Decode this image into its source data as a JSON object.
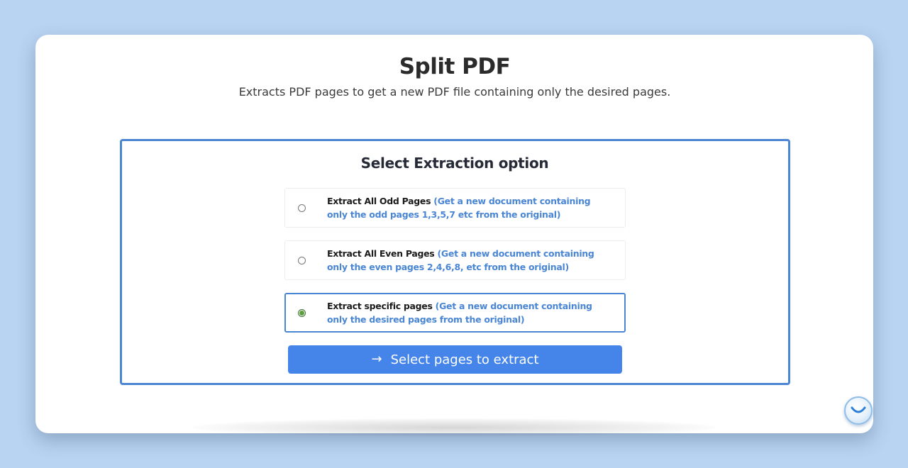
{
  "header": {
    "title": "Split PDF",
    "subtitle": "Extracts PDF pages to get a new PDF file containing only the desired pages."
  },
  "panel": {
    "title": "Select Extraction option",
    "options": [
      {
        "label": "Extract All Odd Pages",
        "description": "(Get a new document containing only the odd pages 1,3,5,7 etc from the original)",
        "selected": false
      },
      {
        "label": "Extract All Even Pages",
        "description": "(Get a new document containing only the even pages 2,4,6,8, etc from the original)",
        "selected": false
      },
      {
        "label": "Extract specific pages",
        "description": "(Get a new document containing only the desired pages from the original)",
        "selected": true
      }
    ],
    "action_button": {
      "icon": "arrow-right-icon",
      "label": "Select pages to extract"
    }
  },
  "chat_widget": {
    "icon": "smile-chat-icon"
  },
  "colors": {
    "background": "#b8d4f2",
    "accent": "#4a86d4",
    "button": "#4585ea",
    "radio_checked": "#5aa03c"
  }
}
